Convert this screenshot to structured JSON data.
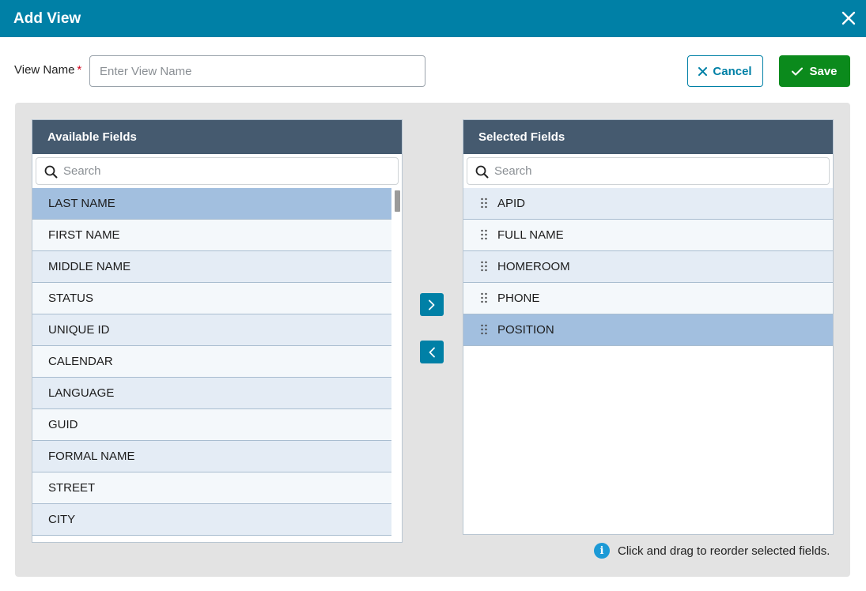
{
  "dialog": {
    "title": "Add View",
    "close_icon": "close-icon"
  },
  "view_name": {
    "label": "View Name",
    "required_mark": "*",
    "placeholder": "Enter View Name",
    "value": ""
  },
  "actions": {
    "cancel_label": "Cancel",
    "save_label": "Save"
  },
  "available": {
    "header": "Available Fields",
    "search_placeholder": "Search",
    "items": [
      "LAST NAME",
      "FIRST NAME",
      "MIDDLE NAME",
      "STATUS",
      "UNIQUE ID",
      "CALENDAR",
      "LANGUAGE",
      "GUID",
      "FORMAL NAME",
      "STREET",
      "CITY"
    ],
    "selected_index": 0
  },
  "selected": {
    "header": "Selected Fields",
    "search_placeholder": "Search",
    "items": [
      "APID",
      "FULL NAME",
      "HOMEROOM",
      "PHONE",
      "POSITION"
    ],
    "selected_index": 4
  },
  "hint": {
    "text": "Click and drag to reorder selected fields.",
    "icon": "info-icon"
  },
  "colors": {
    "header_bar": "#0080a6",
    "panel_header": "#455a6f",
    "save_button": "#0b8a1c",
    "row_selected": "#a2bfdf",
    "row_odd": "#e4ecf5",
    "row_even": "#f4f8fb"
  }
}
